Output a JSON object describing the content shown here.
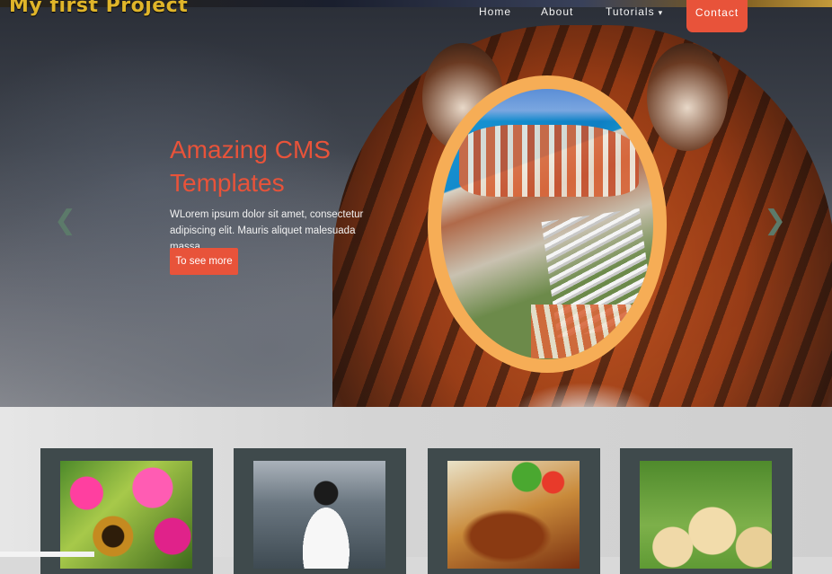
{
  "brand": {
    "title": "My first Project"
  },
  "nav": {
    "items": [
      {
        "label": "Home"
      },
      {
        "label": "About"
      },
      {
        "label": "Tutorials",
        "caret": "▾"
      }
    ],
    "contact_label": "Contact"
  },
  "hero": {
    "title_line1": "Amazing CMS",
    "title_line2": "Templates",
    "text_line1": "WLorem ipsum dolor sit amet, consectetur",
    "text_line2": "adipiscing elit. Mauris aliquet malesuada massa",
    "button_label": "To see more",
    "prev_arrow": "❮",
    "next_arrow": "❯"
  },
  "gallery": {
    "cards": [
      {
        "image": "flower-bee"
      },
      {
        "image": "penguin"
      },
      {
        "image": "grilled-food"
      },
      {
        "image": "puppies"
      }
    ]
  },
  "colors": {
    "accent": "#e8533a",
    "brand": "#e0b52a",
    "oval_frame": "#f6ad56",
    "card_bg": "#3f4a4c"
  }
}
